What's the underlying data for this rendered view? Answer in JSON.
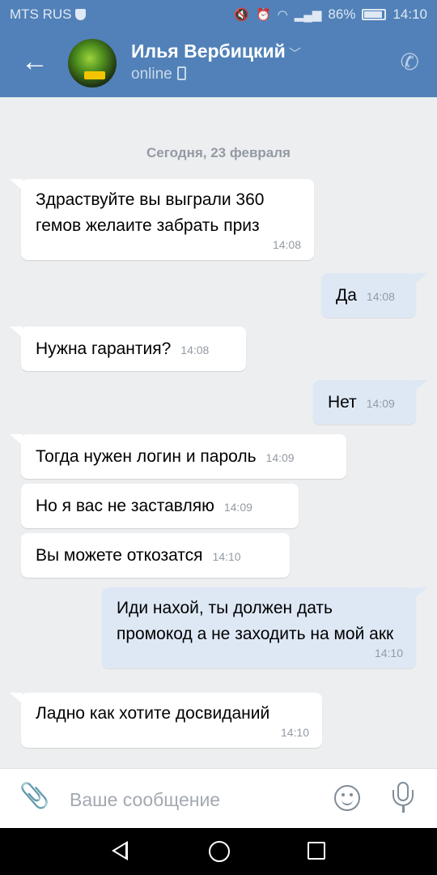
{
  "status_bar": {
    "carrier": "MTS RUS",
    "battery": "86%",
    "time": "14:10"
  },
  "header": {
    "contact_name": "Илья Вербицкий",
    "contact_status": "online"
  },
  "date_separator": "Сегодня, 23 февраля",
  "messages": [
    {
      "direction": "in",
      "text": "Здраствуйте вы выграли 360 гемов желаите забрать приз",
      "time": "14:08"
    },
    {
      "direction": "out",
      "text": "Да",
      "time": "14:08"
    },
    {
      "direction": "in",
      "text": "Нужна гарантия?",
      "time": "14:08"
    },
    {
      "direction": "out",
      "text": "Нет",
      "time": "14:09"
    },
    {
      "direction": "in",
      "text": "Тогда нужен логин и пароль",
      "time": "14:09"
    },
    {
      "direction": "in",
      "text": "Но я вас не заставляю",
      "time": "14:09"
    },
    {
      "direction": "in",
      "text": "Вы можете откозатся",
      "time": "14:10"
    },
    {
      "direction": "out",
      "text": "Иди нахой, ты должен дать промокод а не заходить на мой акк",
      "time": "14:10"
    },
    {
      "direction": "in",
      "text": "Ладно как хотите досвиданий",
      "time": "14:10"
    }
  ],
  "composer": {
    "placeholder": "Ваше сообщение"
  },
  "icons": {
    "back": "arrow-left-icon",
    "call": "phone-icon",
    "attach": "paperclip-icon",
    "emoji": "smile-icon",
    "voice": "microphone-icon"
  },
  "colors": {
    "header_bg": "#5181b8",
    "chat_bg": "#edeef0",
    "incoming_bubble": "#ffffff",
    "outgoing_bubble": "#dee8f5"
  }
}
